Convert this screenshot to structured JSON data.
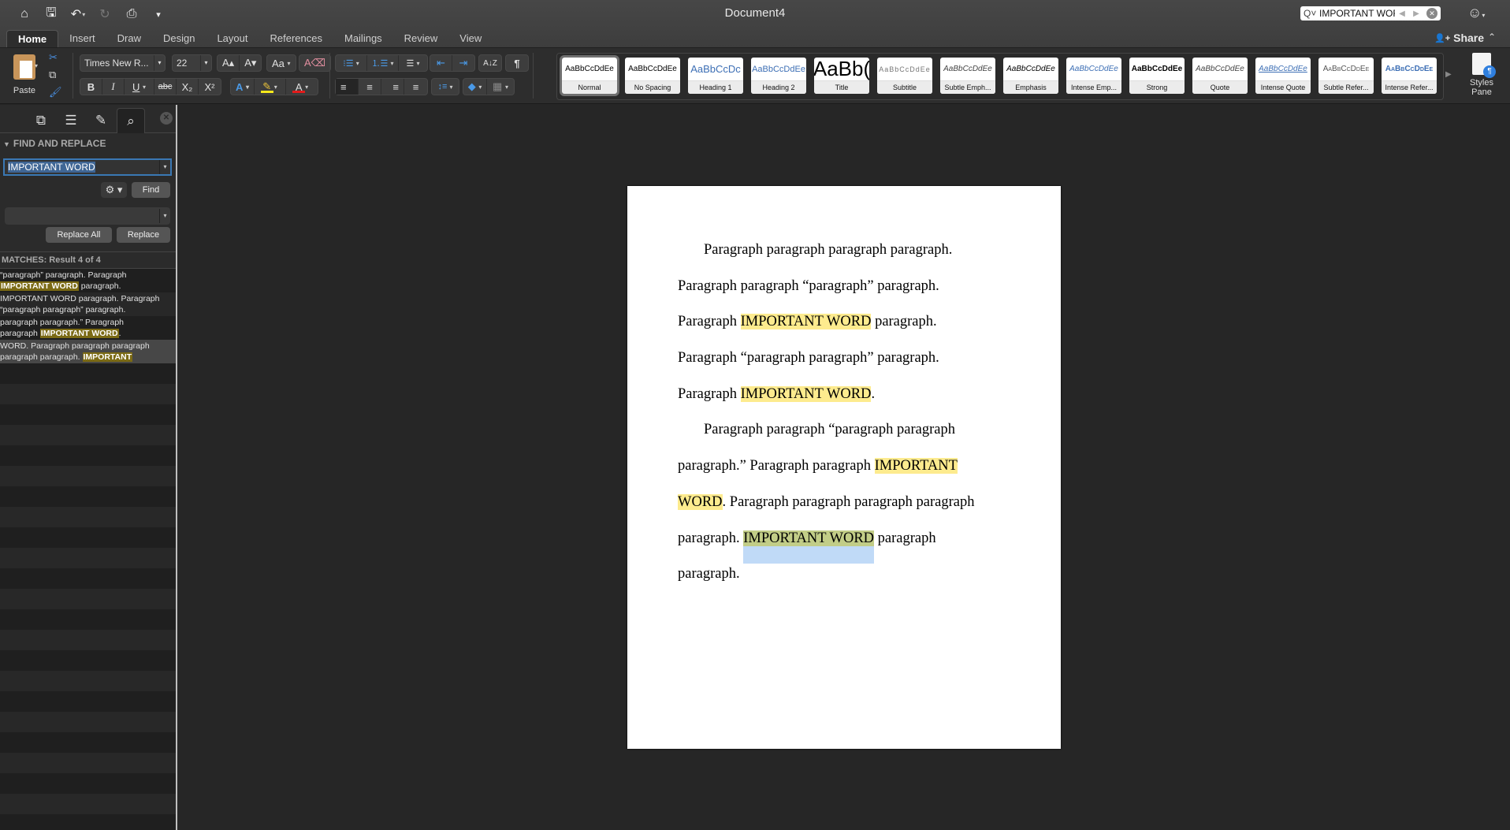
{
  "window": {
    "title": "Document4"
  },
  "quick_access": [
    {
      "name": "home-icon",
      "glyph": "⌂"
    },
    {
      "name": "save-icon",
      "glyph": "🖫"
    },
    {
      "name": "undo-icon",
      "glyph": "↶"
    },
    {
      "name": "redo-icon",
      "glyph": "↻"
    },
    {
      "name": "print-icon",
      "glyph": "⎙"
    },
    {
      "name": "customize-icon",
      "glyph": "▾"
    }
  ],
  "search": {
    "value": "IMPORTANT WORD",
    "icon": "Q˅",
    "prev": "◀",
    "next": "▶",
    "clear": "✕"
  },
  "feedback_icon": "☺",
  "tabs": [
    "Home",
    "Insert",
    "Draw",
    "Design",
    "Layout",
    "References",
    "Mailings",
    "Review",
    "View"
  ],
  "active_tab": "Home",
  "share": {
    "icon": "👤+",
    "label": "Share",
    "collapse": "⌃"
  },
  "ribbon": {
    "paste_label": "Paste",
    "font_name": "Times New R...",
    "font_size": "22",
    "grow_font": "A▴",
    "shrink_font": "A▾",
    "change_case": "Aa",
    "clear_format": "A⌫",
    "bold": "B",
    "italic": "I",
    "underline": "U",
    "strikethrough": "abc",
    "subscript": "X₂",
    "superscript": "X²",
    "text_effects": "A",
    "highlight": "✎",
    "font_color": "A",
    "highlight_color": "#f7e81b",
    "font_color_value": "#e21b1b",
    "bullets": "⁝☰",
    "numbering": "⒈☰",
    "multilevel": "☰",
    "decrease_indent": "⇤",
    "increase_indent": "⇥",
    "sort": "A↓Z",
    "show_marks": "¶",
    "align_left": "≡",
    "align_center": "≡",
    "align_right": "≡",
    "justify": "≡",
    "line_spacing": "↕≡",
    "shading": "◆",
    "borders": "▦",
    "styles_pane_label": "Styles Pane",
    "styles_pane_glyph": "¶",
    "gallery_more": "▶"
  },
  "styles": [
    {
      "preview": "AaBbCcDdEe",
      "name": "Normal",
      "selected": true
    },
    {
      "preview": "AaBbCcDdEe",
      "name": "No Spacing"
    },
    {
      "preview": "AaBbCcDc",
      "name": "Heading 1"
    },
    {
      "preview": "AaBbCcDdEe",
      "name": "Heading 2"
    },
    {
      "preview": "AaBb(",
      "name": "Title"
    },
    {
      "preview": "AaBbCcDdEe",
      "name": "Subtitle"
    },
    {
      "preview": "AaBbCcDdEe",
      "name": "Subtle Emph..."
    },
    {
      "preview": "AaBbCcDdEe",
      "name": "Emphasis"
    },
    {
      "preview": "AaBbCcDdEe",
      "name": "Intense Emp..."
    },
    {
      "preview": "AaBbCcDdEe",
      "name": "Strong"
    },
    {
      "preview": "AaBbCcDdEe",
      "name": "Quote"
    },
    {
      "preview": "AaBbCcDdEe",
      "name": "Intense Quote"
    },
    {
      "preview": "AaBbCcDdEe",
      "name": "Subtle Refer..."
    },
    {
      "preview": "AaBbCcDdEe",
      "name": "Intense Refer..."
    }
  ],
  "sidebar": {
    "tabs": [
      {
        "name": "thumbnails-icon",
        "glyph": "⧉"
      },
      {
        "name": "outline-icon",
        "glyph": "☰"
      },
      {
        "name": "comments-icon",
        "glyph": "✎"
      },
      {
        "name": "search-icon",
        "glyph": "⌕"
      }
    ],
    "close_glyph": "✕",
    "header": "FIND AND REPLACE",
    "header_toggle": "▼",
    "find_value": "IMPORTANT WORD",
    "dropdown_glyph": "▾",
    "options_glyph": "⚙ ▾",
    "find_label": "Find",
    "replace_value": "",
    "replace_all_label": "Replace All",
    "replace_label": "Replace",
    "matches_label": "MATCHES: Result 4 of 4",
    "results": [
      {
        "before1": "“paragraph” paragraph. Paragraph",
        "hl": "IMPORTANT WORD",
        "after": " paragraph."
      },
      {
        "before1": "IMPORTANT WORD paragraph. Paragraph",
        "hl": "",
        "after": "“paragraph paragraph” paragraph."
      },
      {
        "before1": "paragraph paragraph.” Paragraph",
        "hl": "IMPORTANT WORD",
        "after": ".",
        "pre2": "paragraph "
      },
      {
        "before1": "WORD. Paragraph paragraph paragraph",
        "hl": "IMPORTANT",
        "after": "",
        "pre2": "paragraph paragraph. ",
        "current": true
      }
    ]
  },
  "document": {
    "lines": [
      {
        "indent": true,
        "parts": [
          {
            "t": "Paragraph paragraph paragraph paragraph."
          }
        ]
      },
      {
        "parts": [
          {
            "t": "Paragraph paragraph “paragraph” paragraph."
          }
        ]
      },
      {
        "parts": [
          {
            "t": "Paragraph "
          },
          {
            "t": "IMPORTANT WORD",
            "hl": "match"
          },
          {
            "t": " paragraph."
          }
        ]
      },
      {
        "parts": [
          {
            "t": "Paragraph “paragraph paragraph” paragraph."
          }
        ]
      },
      {
        "parts": [
          {
            "t": "Paragraph "
          },
          {
            "t": "IMPORTANT WORD",
            "hl": "match"
          },
          {
            "t": "."
          }
        ]
      },
      {
        "indent": true,
        "parts": [
          {
            "t": "Paragraph paragraph “paragraph paragraph"
          }
        ]
      },
      {
        "parts": [
          {
            "t": "paragraph.” Paragraph paragraph "
          },
          {
            "t": "IMPORTANT",
            "hl": "match"
          }
        ]
      },
      {
        "parts": [
          {
            "t": "WORD",
            "hl": "match"
          },
          {
            "t": ". Paragraph paragraph paragraph paragraph"
          }
        ]
      },
      {
        "parts": [
          {
            "t": "paragraph. "
          },
          {
            "t": "IMPORTANT WORD",
            "hl": "current"
          },
          {
            "t": " paragraph"
          }
        ]
      },
      {
        "parts": [
          {
            "t": "paragraph."
          }
        ]
      }
    ],
    "highlight_color": "#fdeb8e",
    "current_match_color": "#c2cd87",
    "selection_color": "#c0daf7"
  }
}
